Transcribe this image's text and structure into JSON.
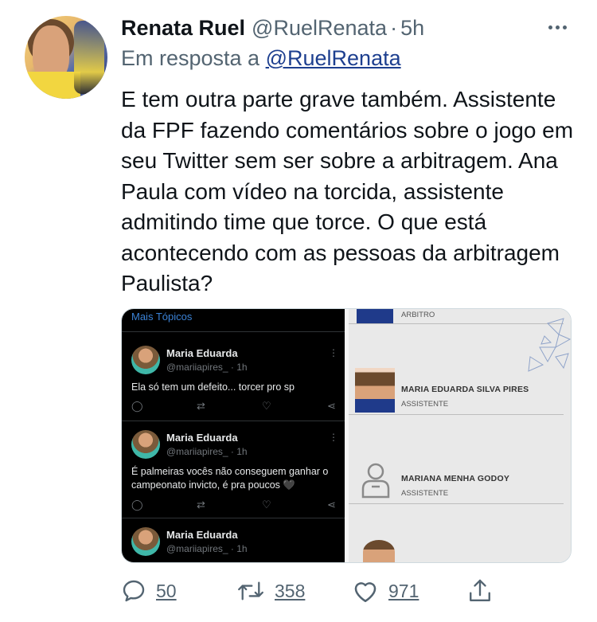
{
  "tweet": {
    "author_name": "Renata Ruel",
    "author_handle": "@RuelRenata",
    "separator": "·",
    "time_ago": "5h",
    "reply_prefix": "Em resposta a",
    "reply_to": "@RuelRenata",
    "text": "E tem outra parte grave também. Assistente da FPF fazendo comentários sobre o jogo em seu Twitter sem ser sobre a arbitragem. Ana Paula com vídeo na torcida, assistente admitindo time que torce. O que está acontecendo com as pessoas da arbitragem Paulista?",
    "replies": "50",
    "retweets": "358",
    "likes": "971"
  },
  "media": {
    "left": {
      "section_title": "Mais Tópicos",
      "tweets": [
        {
          "name": "Maria Eduarda",
          "handle": "@mariiapires_ · 1h",
          "text": "Ela só tem um defeito... torcer pro sp"
        },
        {
          "name": "Maria Eduarda",
          "handle": "@mariiapires_ · 1h",
          "text": "É palmeiras vocês não conseguem ganhar o campeonato invicto, é pra poucos 🖤"
        },
        {
          "name": "Maria Eduarda",
          "handle": "@mariiapires_ · 1h",
          "text": ""
        }
      ]
    },
    "right": {
      "top_role": "ARBITRO",
      "people": [
        {
          "name": "MARIA EDUARDA SILVA PIRES",
          "role": "ASSISTENTE"
        },
        {
          "name": "MARIANA MENHA GODOY",
          "role": "ASSISTENTE"
        }
      ]
    }
  },
  "colors": {
    "link": "#1d3f8f",
    "muted": "#536471",
    "text": "#0f1419",
    "mini_link": "#3b82d6"
  },
  "icons": [
    "more-icon",
    "reply-icon",
    "retweet-icon",
    "like-icon",
    "share-icon",
    "person-placeholder-icon"
  ]
}
